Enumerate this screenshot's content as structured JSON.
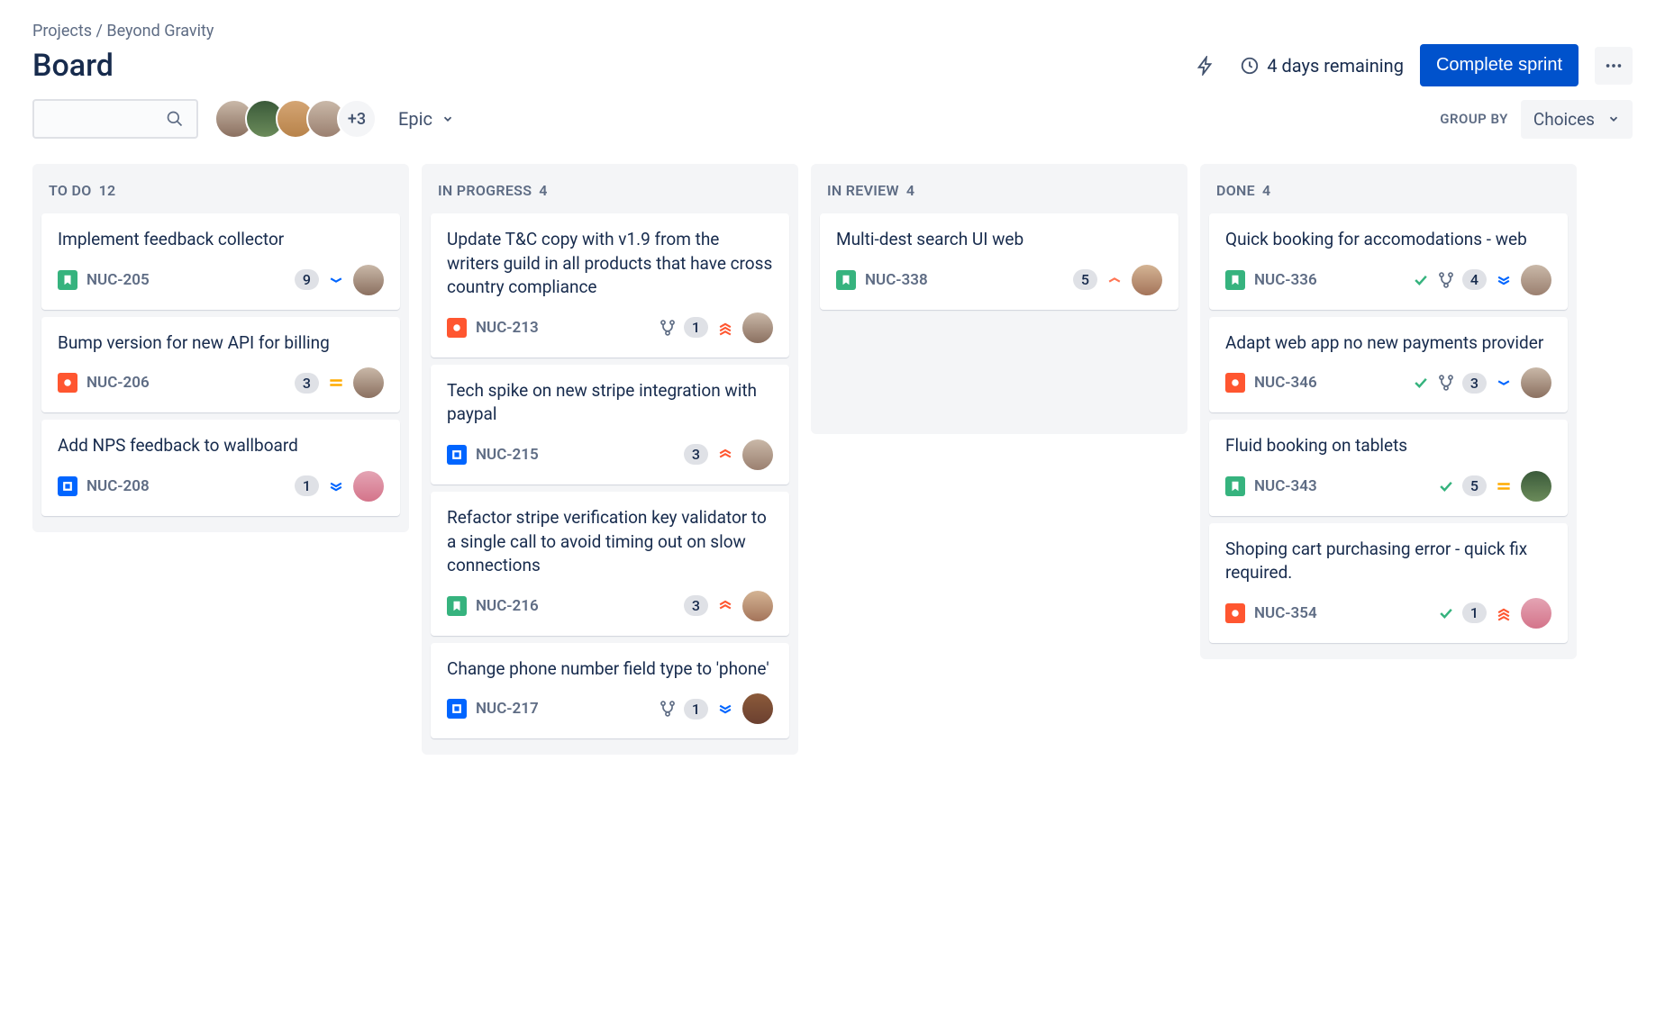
{
  "breadcrumb": {
    "root": "Projects",
    "project": "Beyond Gravity"
  },
  "title": "Board",
  "header": {
    "remaining": "4 days remaining",
    "complete_label": "Complete sprint"
  },
  "toolbar": {
    "avatars_overflow": "+3",
    "filter_label": "Epic",
    "groupby_label": "GROUP BY",
    "groupby_value": "Choices"
  },
  "columns": [
    {
      "name": "TO DO",
      "count": "12",
      "cards": [
        {
          "title": "Implement feedback collector",
          "key": "NUC-205",
          "type": "story",
          "points": "9",
          "priority": "low",
          "assignee": "av1"
        },
        {
          "title": "Bump version for new API for billing",
          "key": "NUC-206",
          "type": "bug",
          "points": "3",
          "priority": "medium",
          "assignee": "av1"
        },
        {
          "title": "Add NPS feedback to wallboard",
          "key": "NUC-208",
          "type": "task",
          "points": "1",
          "priority": "lowest",
          "assignee": "av8"
        }
      ]
    },
    {
      "name": "IN PROGRESS",
      "count": "4",
      "cards": [
        {
          "title": "Update T&C copy with v1.9 from the writers guild in all products that have cross country compliance",
          "key": "NUC-213",
          "type": "bug",
          "branch": true,
          "points": "1",
          "priority": "highest",
          "assignee": "av1"
        },
        {
          "title": "Tech spike on new stripe integration with paypal",
          "key": "NUC-215",
          "type": "task",
          "points": "3",
          "priority": "high",
          "assignee": "av4"
        },
        {
          "title": "Refactor stripe verification key validator to a single call to avoid timing out on slow connections",
          "key": "NUC-216",
          "type": "story",
          "points": "3",
          "priority": "high",
          "assignee": "av6"
        },
        {
          "title": "Change phone number field type to 'phone'",
          "key": "NUC-217",
          "type": "task",
          "branch": true,
          "points": "1",
          "priority": "lowest",
          "assignee": "av7"
        }
      ]
    },
    {
      "name": "IN REVIEW",
      "count": "4",
      "cards": [
        {
          "title": "Multi-dest search UI web",
          "key": "NUC-338",
          "type": "story",
          "points": "5",
          "priority": "medium-up",
          "assignee": "av6"
        }
      ]
    },
    {
      "name": "DONE",
      "count": "4",
      "cards": [
        {
          "title": "Quick booking for accomodations - web",
          "key": "NUC-336",
          "type": "story",
          "done": true,
          "branch": true,
          "points": "4",
          "priority": "lowest",
          "assignee": "av4"
        },
        {
          "title": "Adapt web app no new payments provider",
          "key": "NUC-346",
          "type": "bug",
          "done": true,
          "branch": true,
          "points": "3",
          "priority": "low",
          "assignee": "av1"
        },
        {
          "title": "Fluid booking on tablets",
          "key": "NUC-343",
          "type": "story",
          "done": true,
          "points": "5",
          "priority": "medium",
          "assignee": "av2"
        },
        {
          "title": "Shoping cart purchasing error - quick fix required.",
          "key": "NUC-354",
          "type": "bug",
          "done": true,
          "points": "1",
          "priority": "highest",
          "assignee": "av8"
        }
      ]
    }
  ]
}
